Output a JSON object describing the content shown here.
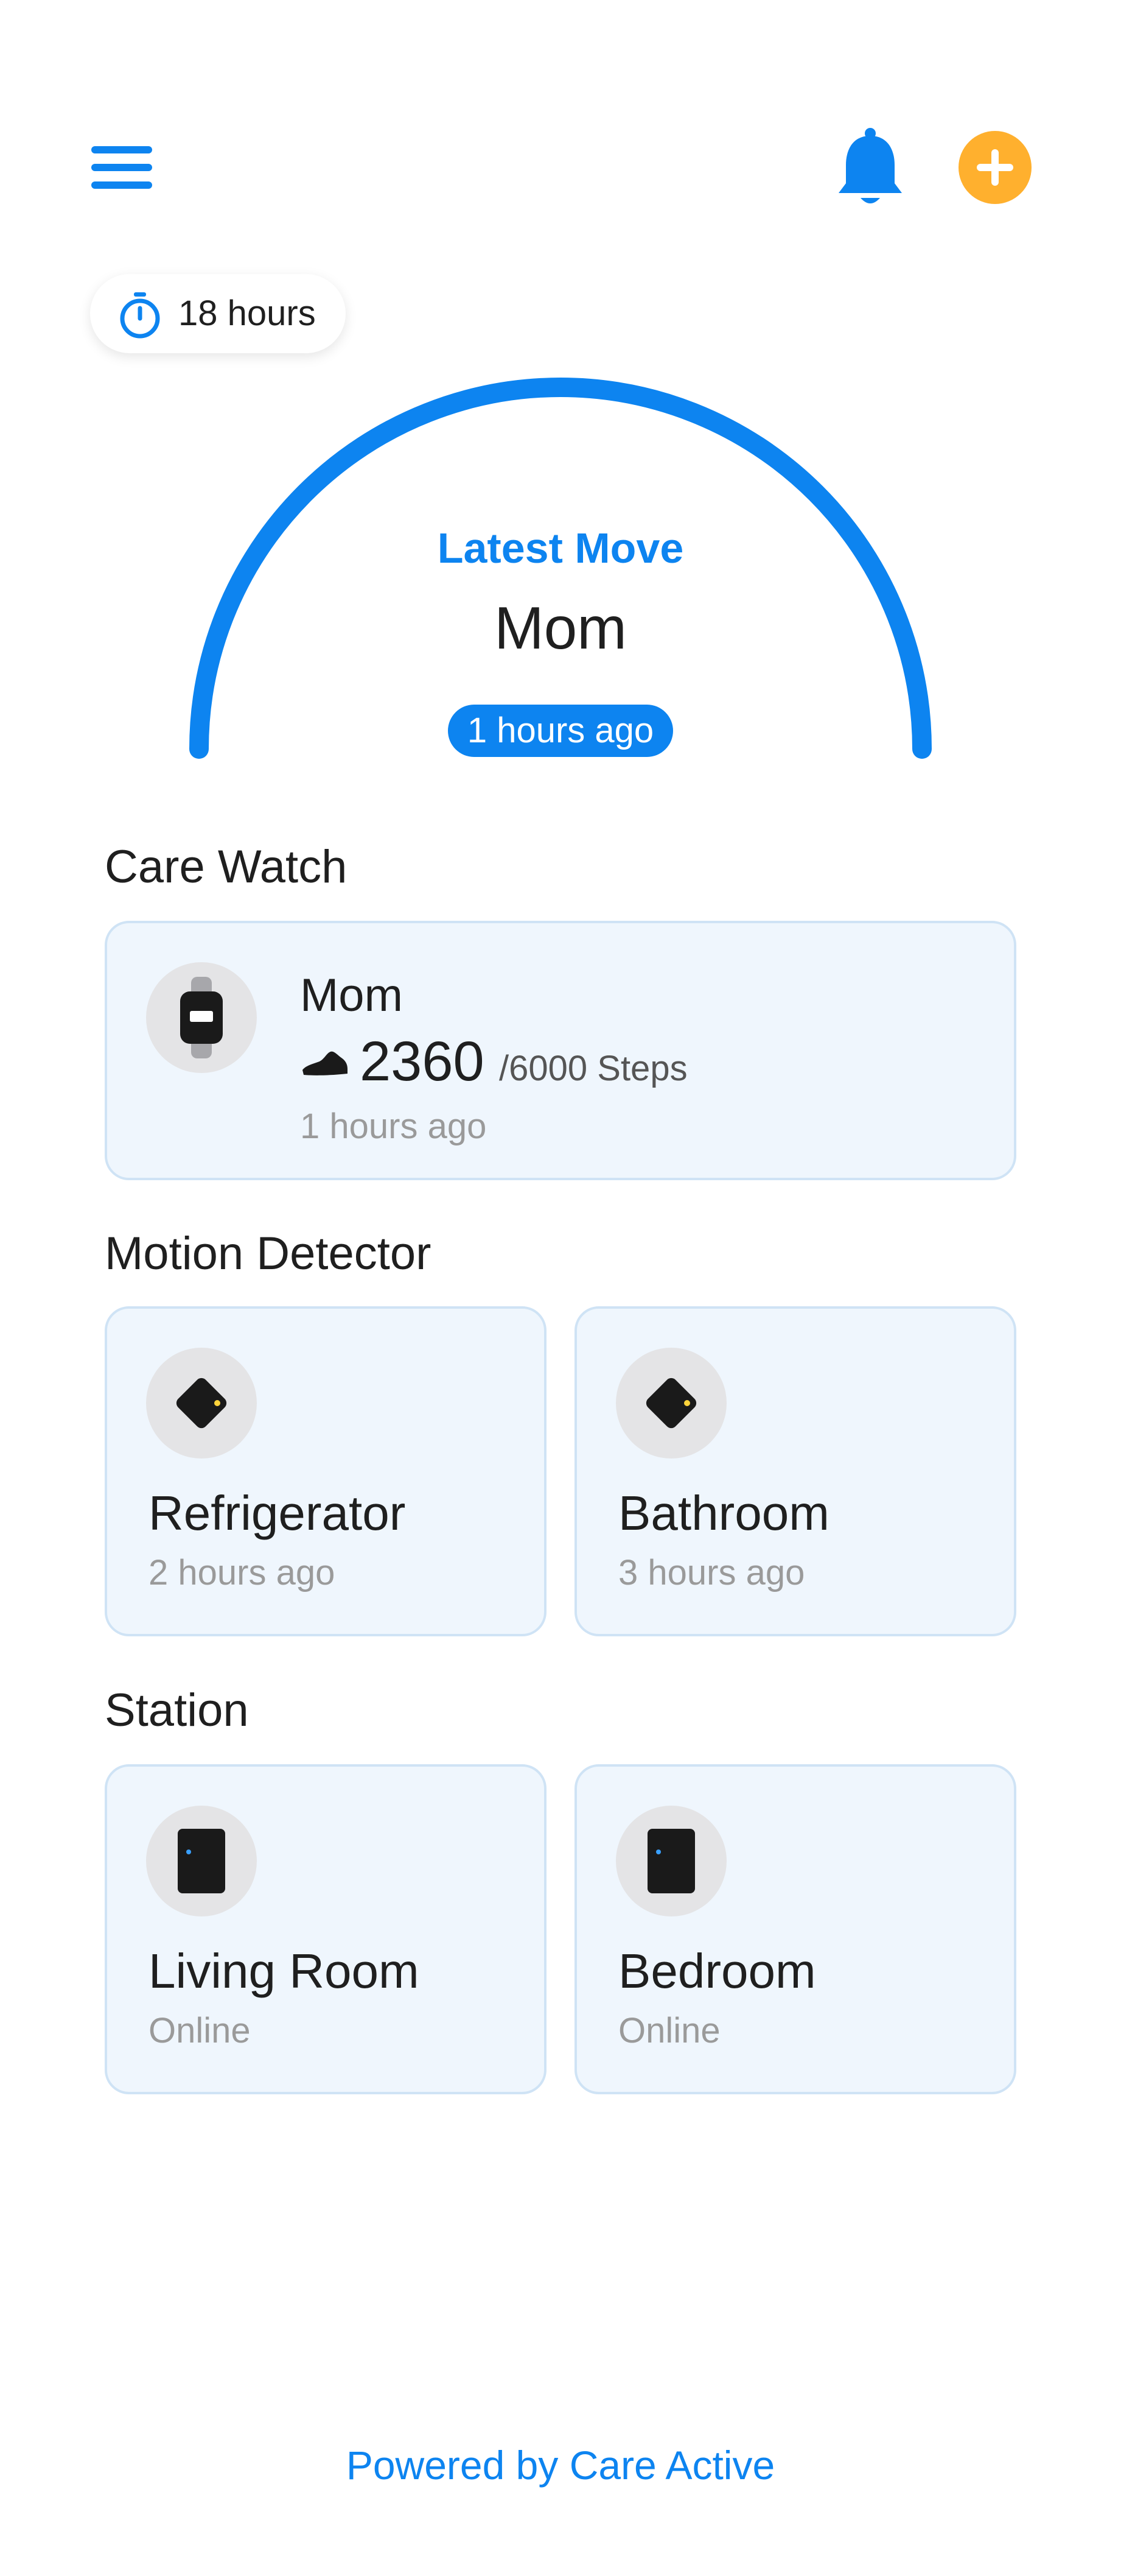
{
  "header": {
    "menu_icon": "hamburger-menu-icon",
    "notification_icon": "bell-icon",
    "add_icon": "plus-icon"
  },
  "timer": {
    "icon": "stopwatch-icon",
    "text": "18 hours"
  },
  "latest_move": {
    "label": "Latest Move",
    "name": "Mom",
    "time": "1 hours ago"
  },
  "care_watch": {
    "title": "Care Watch",
    "device": {
      "icon": "smartwatch-icon",
      "name": "Mom",
      "steps_icon": "shoe-icon",
      "steps": "2360",
      "goal": "/6000 Steps",
      "time": "1 hours ago"
    }
  },
  "motion_detector": {
    "title": "Motion Detector",
    "items": [
      {
        "icon": "motion-sensor-icon",
        "label": "Refrigerator",
        "sub": "2 hours ago"
      },
      {
        "icon": "motion-sensor-icon",
        "label": "Bathroom",
        "sub": "3 hours ago"
      }
    ]
  },
  "station": {
    "title": "Station",
    "items": [
      {
        "icon": "station-device-icon",
        "label": "Living Room",
        "sub": "Online"
      },
      {
        "icon": "station-device-icon",
        "label": "Bedroom",
        "sub": "Online"
      }
    ]
  },
  "footer": {
    "text": "Powered by Care Active"
  },
  "colors": {
    "accent": "#0d84f0",
    "add_button": "#ffb02e",
    "card_background": "#eff6fd",
    "card_border": "#cfe3f5"
  }
}
